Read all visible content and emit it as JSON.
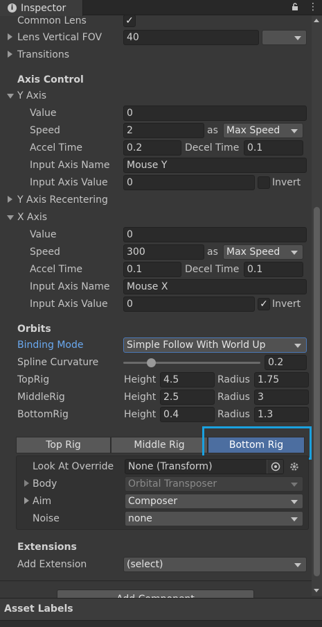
{
  "tab": {
    "title": "Inspector"
  },
  "lens": {
    "common_lens_label": "Common Lens",
    "common_lens_checked": true,
    "fov_label": "Lens Vertical FOV",
    "fov_value": "40",
    "fov_preset": ""
  },
  "transitions_label": "Transitions",
  "axis_control": {
    "heading": "Axis Control",
    "y": {
      "label": "Y Axis",
      "value_label": "Value",
      "value": "0",
      "speed_label": "Speed",
      "speed": "2",
      "as_label": "as",
      "speed_mode": "Max Speed",
      "accel_label": "Accel Time",
      "accel": "0.2",
      "decel_label": "Decel Time",
      "decel": "0.1",
      "input_name_label": "Input Axis Name",
      "input_name": "Mouse Y",
      "input_value_label": "Input Axis Value",
      "input_value": "0",
      "invert_label": "Invert",
      "invert": false
    },
    "recentering_label": "Y Axis Recentering",
    "x": {
      "label": "X Axis",
      "value_label": "Value",
      "value": "0",
      "speed_label": "Speed",
      "speed": "300",
      "as_label": "as",
      "speed_mode": "Max Speed",
      "accel_label": "Accel Time",
      "accel": "0.1",
      "decel_label": "Decel Time",
      "decel": "0.1",
      "input_name_label": "Input Axis Name",
      "input_name": "Mouse X",
      "input_value_label": "Input Axis Value",
      "input_value": "0",
      "invert_label": "Invert",
      "invert": true
    }
  },
  "orbits": {
    "heading": "Orbits",
    "binding_label": "Binding Mode",
    "binding_value": "Simple Follow With World Up",
    "spline_label": "Spline Curvature",
    "spline_value": "0.2",
    "spline_fraction": 0.2,
    "height_label": "Height",
    "radius_label": "Radius",
    "rigs": [
      {
        "name": "TopRig",
        "height": "4.5",
        "radius": "1.75"
      },
      {
        "name": "MiddleRig",
        "height": "2.5",
        "radius": "3"
      },
      {
        "name": "BottomRig",
        "height": "0.4",
        "radius": "1.3"
      }
    ]
  },
  "rig_tabs": [
    "Top Rig",
    "Middle Rig",
    "Bottom Rig"
  ],
  "rig_panel": {
    "look_at_label": "Look At Override",
    "look_at_value": "None (Transform)",
    "body_label": "Body",
    "body_value": "Orbital Transposer",
    "aim_label": "Aim",
    "aim_value": "Composer",
    "noise_label": "Noise",
    "noise_value": "none"
  },
  "extensions": {
    "heading": "Extensions",
    "add_label": "Add Extension",
    "add_value": "(select)"
  },
  "add_component_label": "Add Component",
  "asset_labels": "Asset Labels",
  "colors": {
    "accent_link": "#6aa9f0",
    "highlight": "#1aa1e0",
    "selected_tab": "#4c6ea0"
  }
}
